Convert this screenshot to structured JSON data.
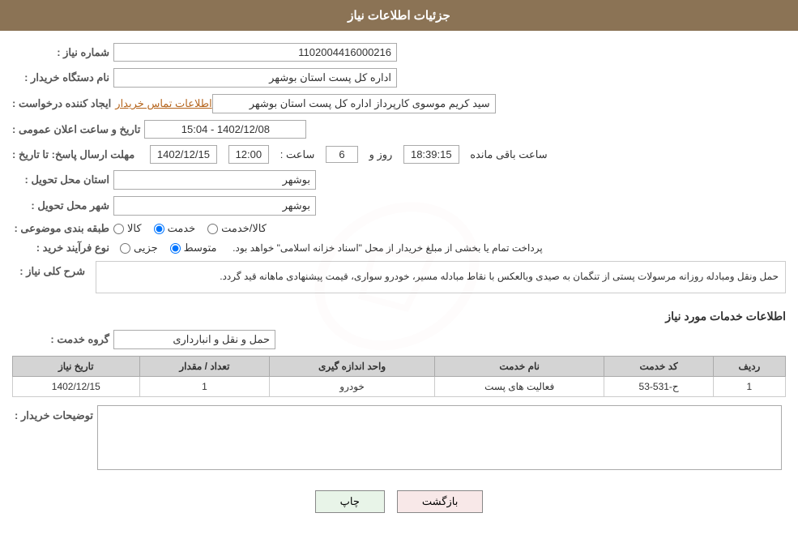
{
  "header": {
    "title": "جزئیات اطلاعات نیاز"
  },
  "fields": {
    "need_number_label": "شماره نیاز :",
    "need_number_value": "1102004416000216",
    "buyer_org_label": "نام دستگاه خریدار :",
    "buyer_org_value": "اداره کل پست استان بوشهر",
    "requester_label": "ایجاد کننده درخواست :",
    "requester_value": "سید کریم موسوی کارپرداز اداره کل پست استان بوشهر",
    "contact_link": "اطلاعات تماس خریدار",
    "announce_date_label": "تاریخ و ساعت اعلان عمومی :",
    "announce_date_value": "1402/12/08 - 15:04",
    "response_deadline_label": "مهلت ارسال پاسخ: تا تاریخ :",
    "response_date": "1402/12/15",
    "response_time_label": "ساعت :",
    "response_time": "12:00",
    "response_days_label": "روز و",
    "response_days": "6",
    "response_remaining_label": "ساعت باقی مانده",
    "response_remaining": "18:39:15",
    "delivery_province_label": "استان محل تحویل :",
    "delivery_province": "بوشهر",
    "delivery_city_label": "شهر محل تحویل :",
    "delivery_city": "بوشهر",
    "category_label": "طبقه بندی موضوعی :",
    "category_options": [
      {
        "label": "کالا",
        "value": "kala"
      },
      {
        "label": "خدمت",
        "value": "khedmat"
      },
      {
        "label": "کالا/خدمت",
        "value": "kala_khedmat"
      }
    ],
    "selected_category": "khedmat",
    "process_label": "نوع فرآیند خرید :",
    "process_options": [
      {
        "label": "جزیی",
        "value": "jozee"
      },
      {
        "label": "متوسط",
        "value": "motavaset"
      }
    ],
    "selected_process": "motavaset",
    "process_note": "پرداخت تمام یا بخشی از مبلغ خریدار از محل \"اسناد خزانه اسلامی\" خواهد بود.",
    "description_label": "شرح کلی نیاز :",
    "description_text": "حمل  ونقل ومبادله روزانه مرسولات پستی از تنگمان به صیدی    وبالعکس با نقاط مبادله مسیر، خودرو سواری، قیمت پیشنهادی ماهانه قید گردد."
  },
  "services_section": {
    "title": "اطلاعات خدمات مورد نیاز",
    "group_label": "گروه خدمت :",
    "group_value": "حمل و نقل و انبارداری",
    "table": {
      "headers": [
        "ردیف",
        "کد خدمت",
        "نام خدمت",
        "واحد اندازه گیری",
        "تعداد / مقدار",
        "تاریخ نیاز"
      ],
      "rows": [
        {
          "row_num": "1",
          "service_code": "ح-531-53",
          "service_name": "فعالیت های پست",
          "unit": "خودرو",
          "quantity": "1",
          "need_date": "1402/12/15"
        }
      ]
    }
  },
  "buyer_notes": {
    "label": "توضیحات خریدار :",
    "value": ""
  },
  "buttons": {
    "print_label": "چاپ",
    "back_label": "بازگشت"
  }
}
